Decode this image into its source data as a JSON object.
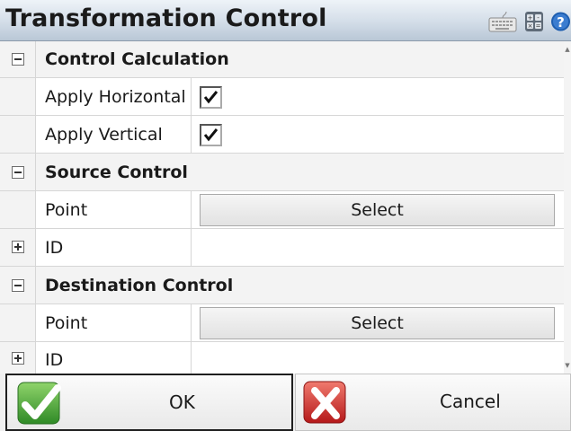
{
  "window": {
    "title": "Transformation Control",
    "toolbar_icons": [
      "keyboard-icon",
      "calculator-icon",
      "help-icon"
    ]
  },
  "sections": [
    {
      "label": "Control Calculation",
      "expanded": true,
      "rows": [
        {
          "label": "Apply Horizontal",
          "type": "checkbox",
          "checked": true
        },
        {
          "label": "Apply Vertical",
          "type": "checkbox",
          "checked": true
        }
      ]
    },
    {
      "label": "Source Control",
      "expanded": true,
      "rows": [
        {
          "label": "Point",
          "type": "button",
          "button_label": "Select"
        },
        {
          "label": "ID",
          "type": "expandable",
          "expanded": false,
          "value": ""
        }
      ]
    },
    {
      "label": "Destination Control",
      "expanded": true,
      "rows": [
        {
          "label": "Point",
          "type": "button",
          "button_label": "Select"
        },
        {
          "label": "ID",
          "type": "expandable",
          "expanded": false,
          "value": ""
        }
      ]
    }
  ],
  "footer": {
    "ok_label": "OK",
    "cancel_label": "Cancel"
  },
  "colors": {
    "ok_icon": "#3aa535",
    "cancel_icon": "#d42a24",
    "help_icon": "#1f5fb0"
  }
}
